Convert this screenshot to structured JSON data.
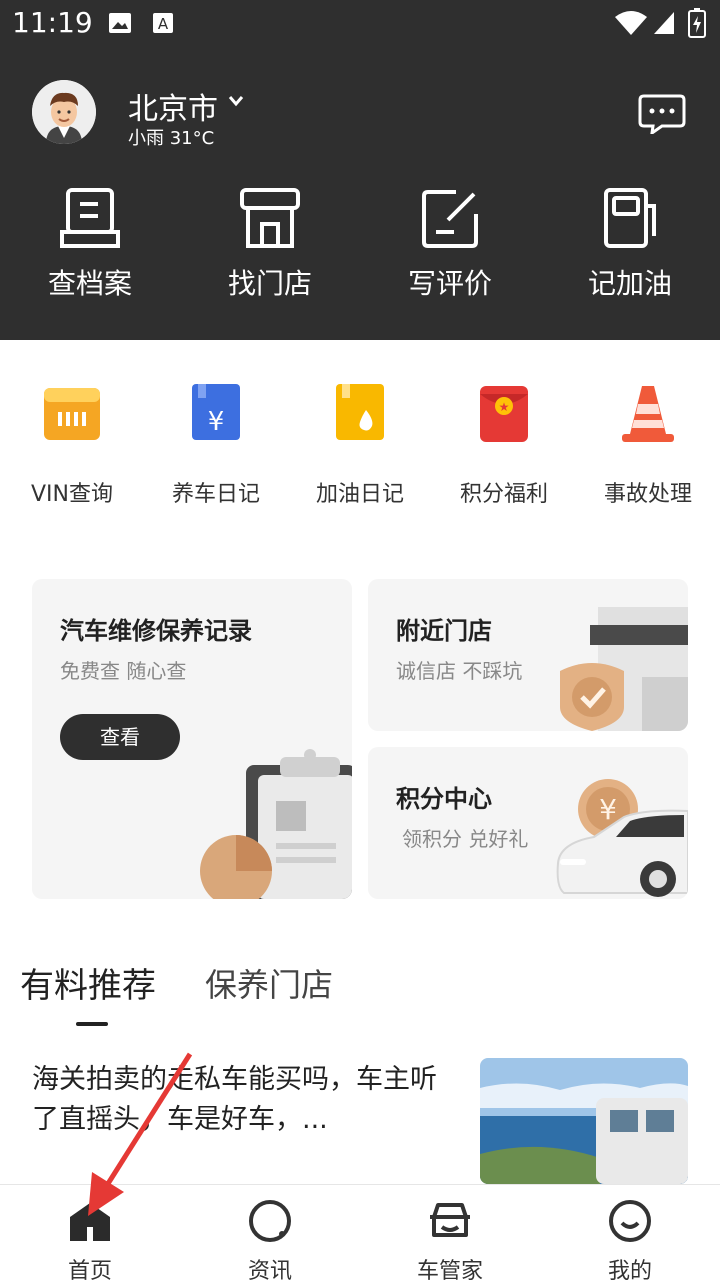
{
  "status_bar": {
    "time": "11:19"
  },
  "header": {
    "city": "北京市",
    "weather": "小雨 31°C"
  },
  "quick_actions": [
    {
      "label": "查档案",
      "icon": "document-tray-icon"
    },
    {
      "label": "找门店",
      "icon": "storefront-icon"
    },
    {
      "label": "写评价",
      "icon": "edit-note-icon"
    },
    {
      "label": "记加油",
      "icon": "fuel-pump-icon"
    }
  ],
  "tools": [
    {
      "label": "VIN查询",
      "icon": "vin-icon",
      "color": "#f5a623"
    },
    {
      "label": "养车日记",
      "icon": "maintenance-diary-icon",
      "color": "#3d6fe0"
    },
    {
      "label": "加油日记",
      "icon": "fuel-diary-icon",
      "color": "#f9b800"
    },
    {
      "label": "积分福利",
      "icon": "red-packet-icon",
      "color": "#e53935"
    },
    {
      "label": "事故处理",
      "icon": "traffic-cone-icon",
      "color": "#f05a3a"
    }
  ],
  "cards": {
    "record": {
      "title": "汽车维修保养记录",
      "subtitle": "免费查 随心查",
      "button": "查看"
    },
    "nearby": {
      "title": "附近门店",
      "subtitle": "诚信店 不踩坑"
    },
    "points": {
      "title": "积分中心",
      "subtitle": "领积分 兑好礼"
    }
  },
  "tabs": [
    {
      "label": "有料推荐",
      "active": true
    },
    {
      "label": "保养门店",
      "active": false
    }
  ],
  "article": {
    "title": "海关拍卖的走私车能买吗，车主听了直摇头，车是好车，..."
  },
  "bottom_nav": [
    {
      "label": "首页",
      "icon": "home-icon",
      "active": true
    },
    {
      "label": "资讯",
      "icon": "news-icon",
      "active": false
    },
    {
      "label": "车管家",
      "icon": "car-butler-icon",
      "active": false
    },
    {
      "label": "我的",
      "icon": "profile-icon",
      "active": false
    }
  ]
}
